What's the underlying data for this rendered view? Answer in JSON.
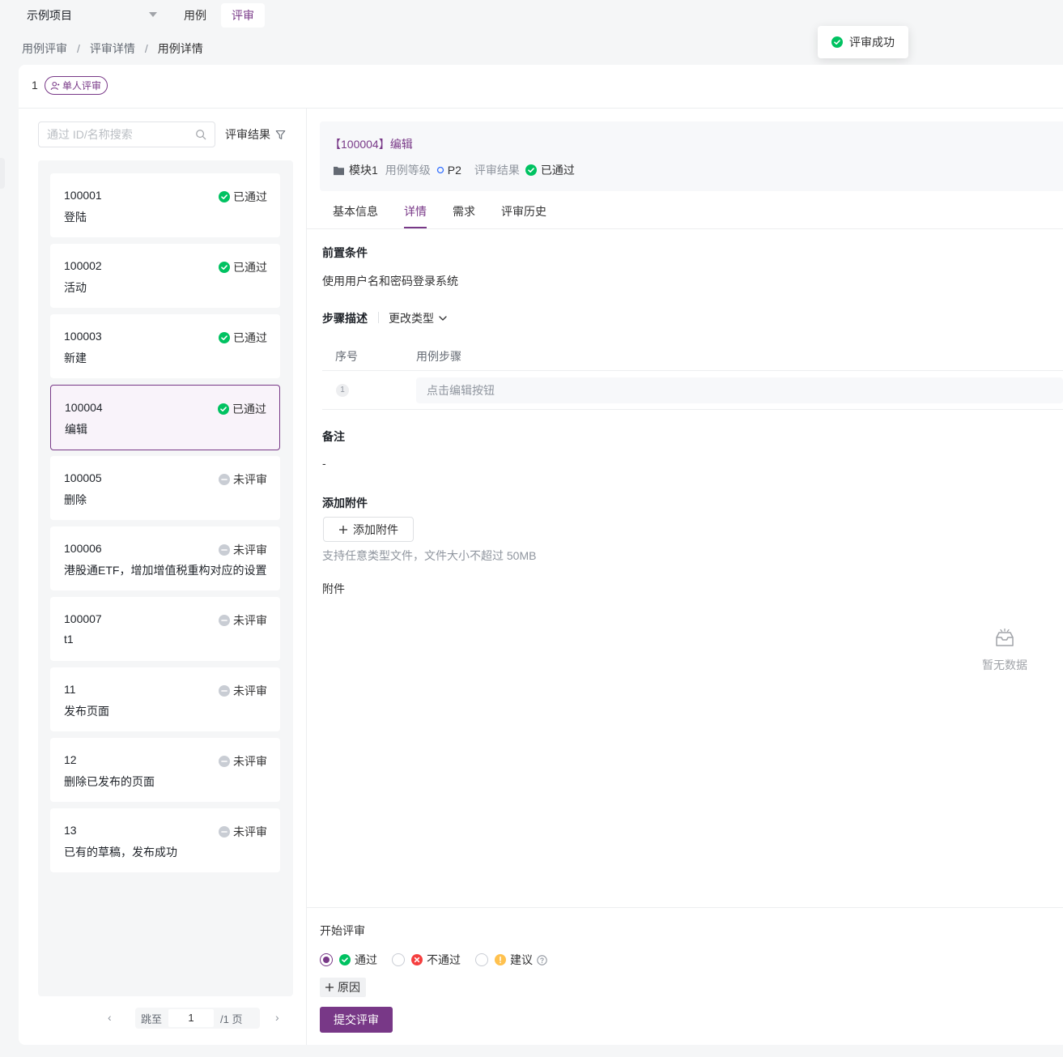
{
  "topbar": {
    "project": "示例项目",
    "tabs": [
      {
        "label": "用例",
        "active": false
      },
      {
        "label": "评审",
        "active": true
      }
    ]
  },
  "breadcrumb": [
    "用例评审",
    "评审详情",
    "用例详情"
  ],
  "breadcrumb_sep": "/",
  "toast": {
    "text": "评审成功"
  },
  "review_head": {
    "number": "1",
    "mode_tag": "单人评审"
  },
  "sidebar": {
    "search_placeholder": "通过 ID/名称搜索",
    "filter_label": "评审结果",
    "cases": [
      {
        "id": "100001",
        "name": "登陆",
        "status": "已通过",
        "status_type": "passed"
      },
      {
        "id": "100002",
        "name": "活动",
        "status": "已通过",
        "status_type": "passed"
      },
      {
        "id": "100003",
        "name": "新建",
        "status": "已通过",
        "status_type": "passed"
      },
      {
        "id": "100004",
        "name": "编辑",
        "status": "已通过",
        "status_type": "passed",
        "selected": true
      },
      {
        "id": "100005",
        "name": "删除",
        "status": "未评审",
        "status_type": "pending"
      },
      {
        "id": "100006",
        "name": "港股通ETF，增加增值税重构对应的设置",
        "status": "未评审",
        "status_type": "pending"
      },
      {
        "id": "100007",
        "name": "t1",
        "status": "未评审",
        "status_type": "pending"
      },
      {
        "id": "11",
        "name": "发布页面",
        "status": "未评审",
        "status_type": "pending"
      },
      {
        "id": "12",
        "name": "删除已发布的页面",
        "status": "未评审",
        "status_type": "pending"
      },
      {
        "id": "13",
        "name": "已有的草稿，发布成功",
        "status": "未评审",
        "status_type": "pending"
      }
    ],
    "pager": {
      "prev": "‹",
      "next": "›",
      "jump_label": "跳至",
      "page": "1",
      "total": "/1 页"
    }
  },
  "detail": {
    "title": "【100004】编辑",
    "module": "模块1",
    "level_label": "用例等级",
    "level": "P2",
    "result_label": "评审结果",
    "result": "已通过",
    "tabs": [
      "基本信息",
      "详情",
      "需求",
      "评审历史"
    ],
    "active_tab": 1,
    "precondition_title": "前置条件",
    "precondition": "使用用户名和密码登录系统",
    "steps_title": "步骤描述",
    "change_type": "更改类型",
    "steps_columns": [
      "序号",
      "用例步骤"
    ],
    "steps": [
      {
        "no": "1",
        "text": "点击编辑按钮"
      }
    ],
    "remark_title": "备注",
    "remark": "-",
    "attach_title": "添加附件",
    "attach_button": "添加附件",
    "attach_hint": "支持任意类型文件，文件大小不超过 50MB",
    "attachments_title": "附件",
    "empty_text": "暂无数据"
  },
  "review": {
    "label": "开始评审",
    "options": [
      {
        "label": "通过",
        "checked": true
      },
      {
        "label": "不通过",
        "checked": false
      },
      {
        "label": "建议",
        "checked": false
      }
    ],
    "reason_button": "原因",
    "submit": "提交评审"
  },
  "colors": {
    "accent": "#783887",
    "passed": "#00c261",
    "failed": "#f53f3f",
    "suggest": "#ffc14e",
    "pending": "#c9cdd4"
  }
}
